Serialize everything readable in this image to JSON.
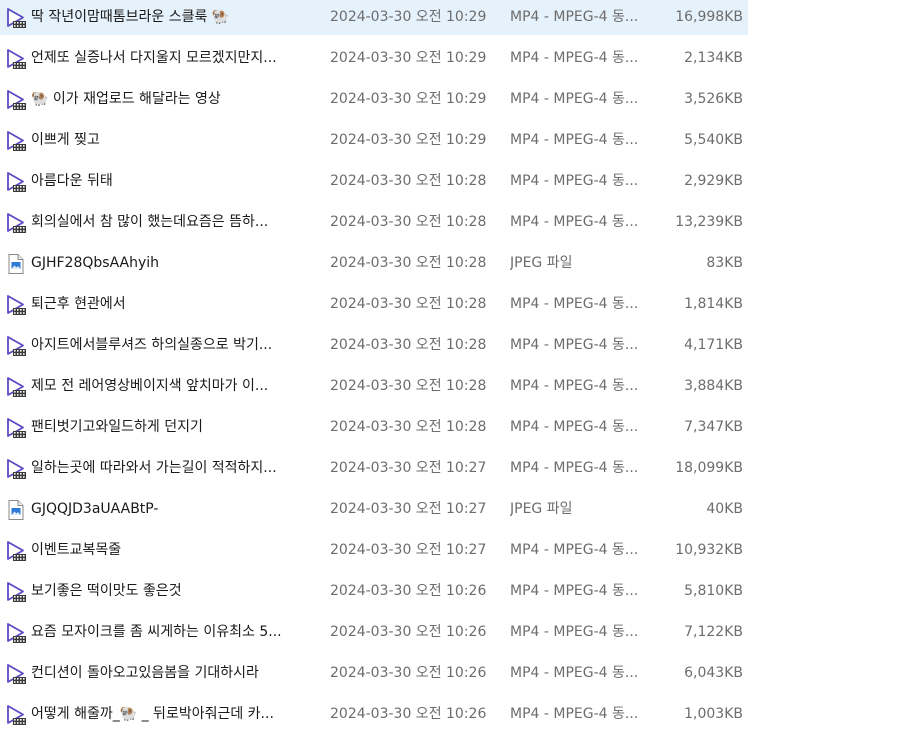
{
  "colors": {
    "selected_row_bg": "#e5f1fb",
    "video_icon_accent": "#5b4bc4",
    "jpeg_icon_accent": "#2f7ad8"
  },
  "files": [
    {
      "name": "딱 작년이맘때톰브라운 스클룩 🐏",
      "date": "2024-03-30 오전 10:29",
      "type": "MP4 - MPEG-4 동...",
      "size": "16,998KB",
      "icon": "video-file-icon",
      "selected": true
    },
    {
      "name": "언제또 실증나서 다지울지 모르겠지만지...",
      "date": "2024-03-30 오전 10:29",
      "type": "MP4 - MPEG-4 동...",
      "size": "2,134KB",
      "icon": "video-file-icon"
    },
    {
      "name": "🐏 이가 재업로드 해달라는 영상",
      "date": "2024-03-30 오전 10:29",
      "type": "MP4 - MPEG-4 동...",
      "size": "3,526KB",
      "icon": "video-file-icon"
    },
    {
      "name": "이쁘게 찢고",
      "date": "2024-03-30 오전 10:29",
      "type": "MP4 - MPEG-4 동...",
      "size": "5,540KB",
      "icon": "video-file-icon"
    },
    {
      "name": "아름다운 뒤태",
      "date": "2024-03-30 오전 10:28",
      "type": "MP4 - MPEG-4 동...",
      "size": "2,929KB",
      "icon": "video-file-icon"
    },
    {
      "name": "회의실에서 참 많이 했는데요즘은 뜸하...",
      "date": "2024-03-30 오전 10:28",
      "type": "MP4 - MPEG-4 동...",
      "size": "13,239KB",
      "icon": "video-file-icon"
    },
    {
      "name": "GJHF28QbsAAhyih",
      "date": "2024-03-30 오전 10:28",
      "type": "JPEG 파일",
      "size": "83KB",
      "icon": "jpeg-file-icon"
    },
    {
      "name": "퇴근후 현관에서",
      "date": "2024-03-30 오전 10:28",
      "type": "MP4 - MPEG-4 동...",
      "size": "1,814KB",
      "icon": "video-file-icon"
    },
    {
      "name": "아지트에서블루셔즈 하의실종으로 박기...",
      "date": "2024-03-30 오전 10:28",
      "type": "MP4 - MPEG-4 동...",
      "size": "4,171KB",
      "icon": "video-file-icon"
    },
    {
      "name": "제모 전 레어영상베이지색 앞치마가 이...",
      "date": "2024-03-30 오전 10:28",
      "type": "MP4 - MPEG-4 동...",
      "size": "3,884KB",
      "icon": "video-file-icon"
    },
    {
      "name": "팬티벗기고와일드하게 던지기",
      "date": "2024-03-30 오전 10:28",
      "type": "MP4 - MPEG-4 동...",
      "size": "7,347KB",
      "icon": "video-file-icon"
    },
    {
      "name": "일하는곳에 따라와서 가는길이 적적하지...",
      "date": "2024-03-30 오전 10:27",
      "type": "MP4 - MPEG-4 동...",
      "size": "18,099KB",
      "icon": "video-file-icon"
    },
    {
      "name": "GJQQJD3aUAABtP-",
      "date": "2024-03-30 오전 10:27",
      "type": "JPEG 파일",
      "size": "40KB",
      "icon": "jpeg-file-icon"
    },
    {
      "name": "이벤트교복목줄",
      "date": "2024-03-30 오전 10:27",
      "type": "MP4 - MPEG-4 동...",
      "size": "10,932KB",
      "icon": "video-file-icon"
    },
    {
      "name": "보기좋은 떡이맛도 좋은것",
      "date": "2024-03-30 오전 10:26",
      "type": "MP4 - MPEG-4 동...",
      "size": "5,810KB",
      "icon": "video-file-icon"
    },
    {
      "name": "요즘 모자이크를 좀 씨게하는 이유최소 5...",
      "date": "2024-03-30 오전 10:26",
      "type": "MP4 - MPEG-4 동...",
      "size": "7,122KB",
      "icon": "video-file-icon"
    },
    {
      "name": "컨디션이 돌아오고있음봄을 기대하시라",
      "date": "2024-03-30 오전 10:26",
      "type": "MP4 - MPEG-4 동...",
      "size": "6,043KB",
      "icon": "video-file-icon"
    },
    {
      "name": "어떻게 해줄까_🐏 _ 뒤로박아줘근데 카...",
      "date": "2024-03-30 오전 10:26",
      "type": "MP4 - MPEG-4 동...",
      "size": "1,003KB",
      "icon": "video-file-icon"
    }
  ]
}
